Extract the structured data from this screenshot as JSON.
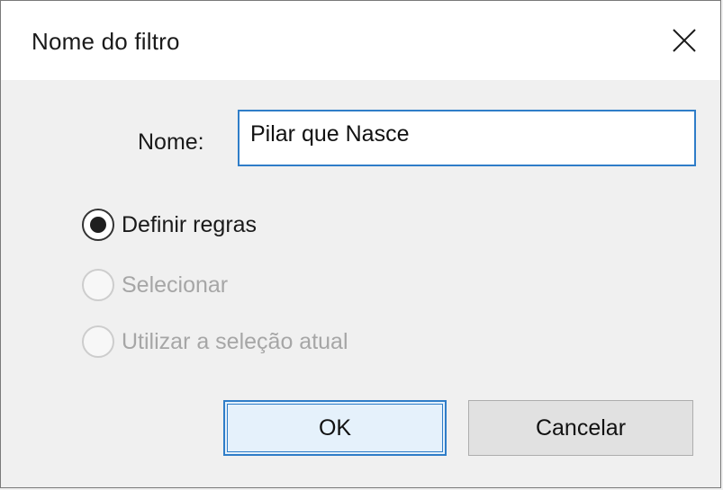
{
  "dialog": {
    "title": "Nome do filtro",
    "close_icon": "close-icon"
  },
  "name_field": {
    "label": "Nome:",
    "value": "Pilar que Nasce"
  },
  "options": [
    {
      "label": "Definir regras",
      "checked": true,
      "enabled": true
    },
    {
      "label": "Selecionar",
      "checked": false,
      "enabled": false
    },
    {
      "label": "Utilizar a seleção atual",
      "checked": false,
      "enabled": false
    }
  ],
  "buttons": {
    "ok_label": "OK",
    "cancel_label": "Cancelar"
  },
  "colors": {
    "accent": "#2f7dc8",
    "background": "#f0f0f0",
    "disabled_text": "#a6a6a6"
  }
}
